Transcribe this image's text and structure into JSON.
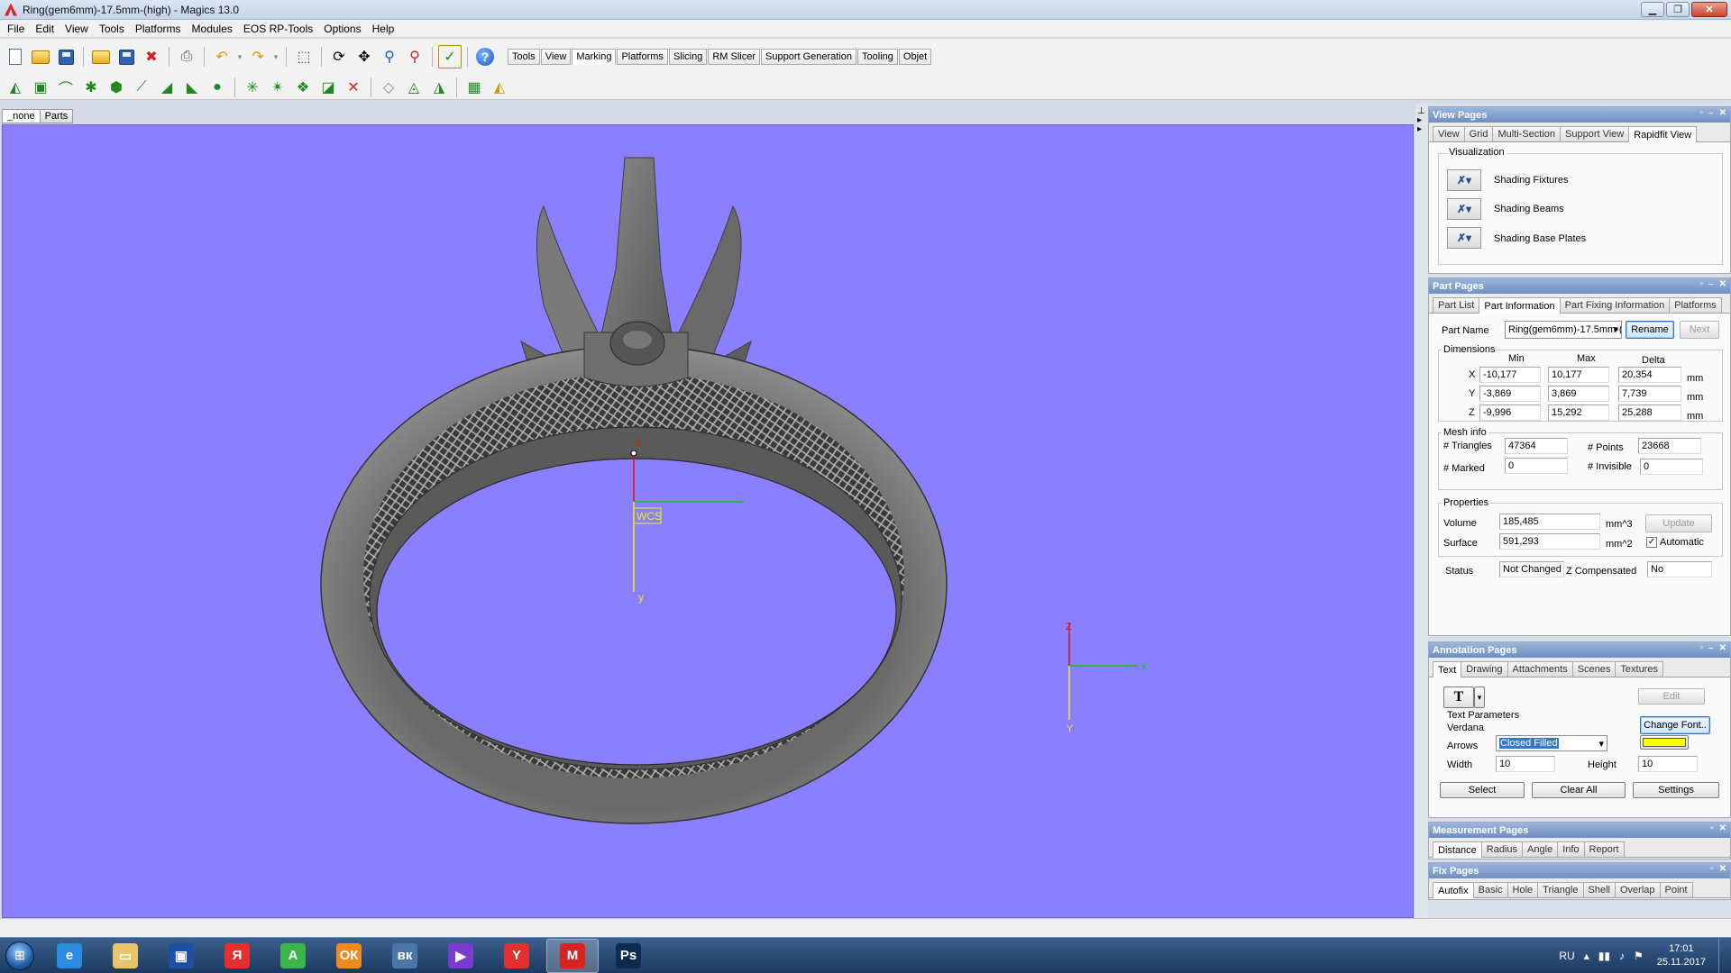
{
  "window": {
    "title": "Ring(gem6mm)-17.5mm-(high) - Magics 13.0"
  },
  "menu": [
    "File",
    "Edit",
    "View",
    "Tools",
    "Platforms",
    "Modules",
    "EOS RP-Tools",
    "Options",
    "Help"
  ],
  "toolbar_tabs": [
    "Tools",
    "View",
    "Marking",
    "Platforms",
    "Slicing",
    "RM Slicer",
    "Support Generation",
    "Tooling",
    "Objet"
  ],
  "toolbar_active_tab": "Marking",
  "view_tabs": [
    "_none",
    "Parts"
  ],
  "viewport": {
    "background": "#8a80ff",
    "wcs_label": "WCS",
    "axis_z": "z",
    "axis_y": "y",
    "mini_axis_z": "Z",
    "mini_axis_x": "X",
    "mini_axis_y": "Y"
  },
  "view_pages": {
    "title": "View Pages",
    "tabs": [
      "View",
      "Grid",
      "Multi-Section",
      "Support View",
      "Rapidfit View"
    ],
    "visualization_label": "Visualization",
    "items": [
      "Shading Fixtures",
      "Shading Beams",
      "Shading Base Plates"
    ]
  },
  "part_pages": {
    "title": "Part Pages",
    "tabs": [
      "Part List",
      "Part Information",
      "Part Fixing Information",
      "Platforms"
    ],
    "part_name_label": "Part Name",
    "part_name_value": "Ring(gem6mm)-17.5mm-(high)",
    "rename_button": "Rename",
    "next_button": "Next",
    "dimensions_label": "Dimensions",
    "col_min": "Min",
    "col_max": "Max",
    "col_delta": "Delta",
    "unit_mm": "mm",
    "rows": [
      {
        "axis": "X",
        "min": "-10,177",
        "max": "10,177",
        "delta": "20,354"
      },
      {
        "axis": "Y",
        "min": "-3,869",
        "max": "3,869",
        "delta": "7,739"
      },
      {
        "axis": "Z",
        "min": "-9,996",
        "max": "15,292",
        "delta": "25,288"
      }
    ],
    "mesh_info_label": "Mesh info",
    "triangles_label": "# Triangles",
    "triangles_value": "47364",
    "points_label": "# Points",
    "points_value": "23668",
    "marked_label": "# Marked",
    "marked_value": "0",
    "invisible_label": "# Invisible",
    "invisible_value": "0",
    "properties_label": "Properties",
    "volume_label": "Volume",
    "volume_value": "185,485",
    "volume_unit": "mm^3",
    "surface_label": "Surface",
    "surface_value": "591,293",
    "surface_unit": "mm^2",
    "update_button": "Update",
    "automatic_label": "Automatic",
    "status_label": "Status",
    "status_value": "Not Changed",
    "zcomp_label": "Z Compensated",
    "zcomp_value": "No"
  },
  "annotation_pages": {
    "title": "Annotation Pages",
    "tabs": [
      "Text",
      "Drawing",
      "Attachments",
      "Scenes",
      "Textures"
    ],
    "text_tool": "T",
    "edit_button": "Edit",
    "text_params_label": "Text Parameters",
    "font_name": "Verdana",
    "change_font_button": "Change Font..",
    "arrows_label": "Arrows",
    "arrows_value": "Closed Filled",
    "color": "#ffff00",
    "width_label": "Width",
    "width_value": "10",
    "height_label": "Height",
    "height_value": "10",
    "select_button": "Select",
    "clear_all_button": "Clear All",
    "settings_button": "Settings"
  },
  "measurement_pages": {
    "title": "Measurement Pages",
    "tabs": [
      "Distance",
      "Radius",
      "Angle",
      "Info",
      "Report"
    ]
  },
  "fix_pages": {
    "title": "Fix Pages",
    "tabs": [
      "Autofix",
      "Basic",
      "Hole",
      "Triangle",
      "Shell",
      "Overlap",
      "Point"
    ]
  },
  "taskbar": {
    "apps": [
      {
        "name": "internet-explorer",
        "glyph": "e",
        "color": "#2a8be0"
      },
      {
        "name": "file-explorer",
        "glyph": "▭",
        "color": "#e9c46a"
      },
      {
        "name": "save-app",
        "glyph": "▣",
        "color": "#1e4fa3"
      },
      {
        "name": "yandex-browser",
        "glyph": "Я",
        "color": "#e52f2f"
      },
      {
        "name": "a-app",
        "glyph": "A",
        "color": "#3bb54a"
      },
      {
        "name": "odnoklassniki",
        "glyph": "ОК",
        "color": "#f08a1c"
      },
      {
        "name": "vkontakte",
        "glyph": "вк",
        "color": "#4a76a8"
      },
      {
        "name": "media-player",
        "glyph": "▶",
        "color": "#7a3bd1"
      },
      {
        "name": "yandex",
        "glyph": "Y",
        "color": "#e52f2f"
      },
      {
        "name": "magics",
        "glyph": "M",
        "color": "#d8231f"
      },
      {
        "name": "photoshop",
        "glyph": "Ps",
        "color": "#0d2b4f"
      }
    ],
    "language": "RU",
    "time": "17:01",
    "date": "25.11.2017"
  }
}
